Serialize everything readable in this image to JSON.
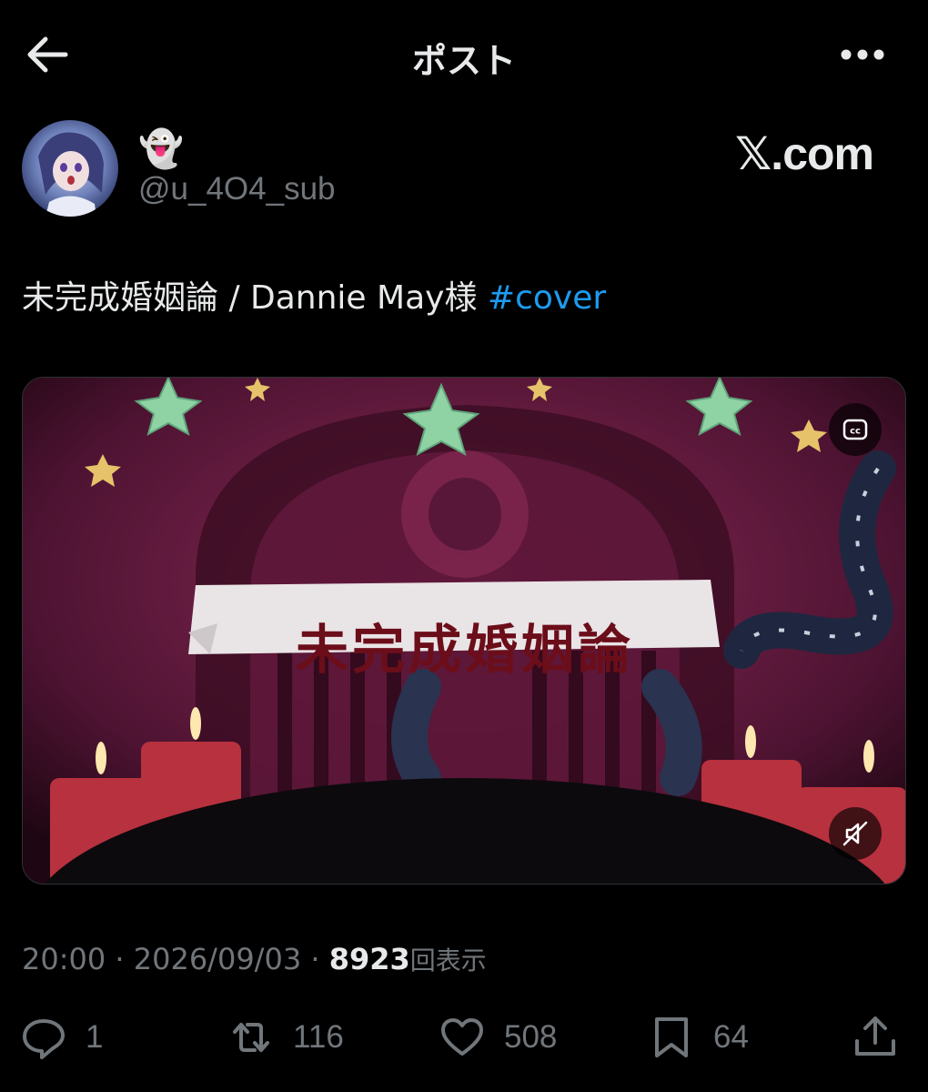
{
  "header": {
    "title": "ポスト",
    "back_icon": "arrow-left-icon",
    "more_icon": "more-horizontal-icon"
  },
  "author": {
    "display_name": "👻",
    "handle": "@u_4O4_sub"
  },
  "source_label": "𝕏.com",
  "tweet": {
    "text": "未完成婚姻論 / Dannie May様 ",
    "hashtag": "#cover"
  },
  "media": {
    "overlay_title": "未完成婚姻論",
    "cc_icon": "closed-captions-icon",
    "mute_icon": "muted-speaker-icon"
  },
  "meta": {
    "time": "20:00",
    "separator": " · ",
    "date": "2026/09/03",
    "views": "8923",
    "views_label": "回表示"
  },
  "actions": {
    "reply_count": "1",
    "repost_count": "116",
    "like_count": "508",
    "bookmark_count": "64"
  },
  "colors": {
    "background": "#000000",
    "text": "#e7e9ea",
    "muted": "#71767b",
    "link": "#1d9bf0"
  }
}
